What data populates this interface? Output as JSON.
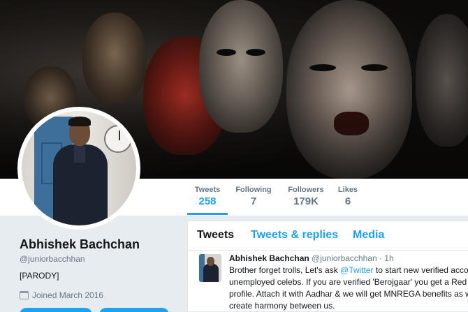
{
  "profile": {
    "name": "Abhishek Bachchan",
    "handle": "@juniorbacchhan",
    "bio": "[PARODY]",
    "joined": "Joined March 2016"
  },
  "stats": [
    {
      "label": "Tweets",
      "value": "258"
    },
    {
      "label": "Following",
      "value": "7"
    },
    {
      "label": "Followers",
      "value": "179K"
    },
    {
      "label": "Likes",
      "value": "6"
    }
  ],
  "tabs": {
    "tweets": "Tweets",
    "replies": "Tweets & replies",
    "media": "Media"
  },
  "tweet": {
    "author": "Abhishek Bachchan",
    "meta": " @juniorbacchhan · 1h",
    "line1_pre": "Brother forget trolls, Let's ask ",
    "mention": "@Twitter",
    "line1_post": " to start new verified accou",
    "line2": "unemployed celebs. If you are verified 'Berojgaar' you get a Red m",
    "line3": "profile. Attach it with Aadhar & we will get MNREGA benefits as w",
    "line4": "create harmony between us."
  },
  "colors": {
    "accent": "#1da1f2",
    "muted": "#657786",
    "background": "#e6ecf0"
  }
}
